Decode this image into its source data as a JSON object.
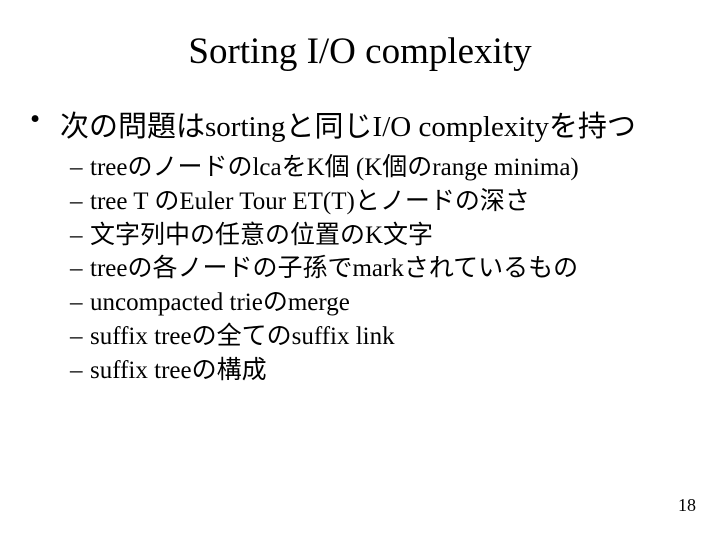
{
  "slide": {
    "title": "Sorting I/O complexity",
    "bullet1": "次の問題はsortingと同じI/O complexityを持つ",
    "sub": [
      "treeのノードのlcaをK個 (K個のrange minima)",
      "tree T のEuler Tour ET(T)とノードの深さ",
      "文字列中の任意の位置のK文字",
      "treeの各ノードの子孫でmarkされているもの",
      "uncompacted trieのmerge",
      "suffix treeの全てのsuffix link",
      "suffix treeの構成"
    ],
    "page": "18",
    "bulletChar": "•",
    "dashChar": "–"
  }
}
